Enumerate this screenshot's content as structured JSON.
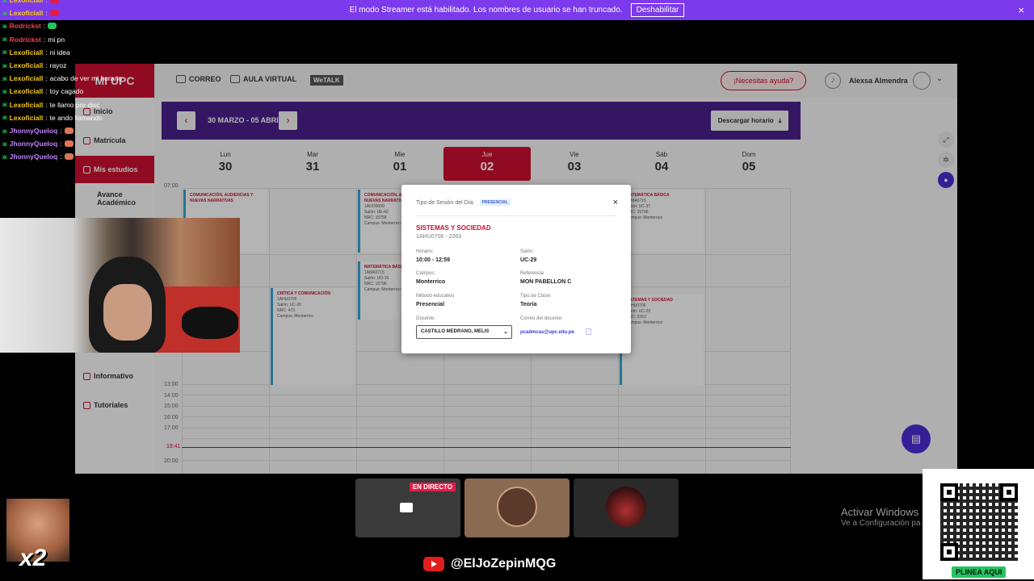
{
  "banner": {
    "message": "El modo Streamer está habilitado. Los nombres de usuario se han truncado.",
    "button": "Deshabilitar",
    "close": "×"
  },
  "portal": {
    "logo": "MI UPC",
    "nav": {
      "correo": "CORREO",
      "aula": "AULA VIRTUAL",
      "wetalk": "WeTALK"
    },
    "help": "¡Necesitas ayuda?",
    "user": "Alexsa Almendra",
    "sidebar": [
      {
        "label": "Inicio"
      },
      {
        "label": "Matrícula"
      },
      {
        "label": "Mis estudios"
      },
      {
        "label": "Avance Académico"
      },
      {
        "label": "Informativo"
      },
      {
        "label": "Tutoriales"
      }
    ],
    "week": {
      "range": "30 MARZO - 05 ABRIL",
      "download": "Descargar horario",
      "prev": "‹",
      "next": "›"
    },
    "days": [
      {
        "name": "Lun",
        "num": "30"
      },
      {
        "name": "Mar",
        "num": "31"
      },
      {
        "name": "Mie",
        "num": "01"
      },
      {
        "name": "Jue",
        "num": "02"
      },
      {
        "name": "Vie",
        "num": "03"
      },
      {
        "name": "Sáb",
        "num": "04"
      },
      {
        "name": "Dom",
        "num": "05"
      }
    ],
    "times": [
      "07:00",
      "13:00",
      "14:00",
      "15:00",
      "16:00",
      "17:00",
      "18:41",
      "20:00"
    ],
    "events": [
      {
        "title": "COMUNICACIÓN, AUDIENCIAS Y NUEVAS NARRATIVAS",
        "lines": []
      },
      {
        "title": "COMUNICACIÓN, AUDIENCIAS Y NUEVAS NARRATIVAS",
        "lines": [
          "1ADO0099",
          "Salón: UE-42",
          "NRC: 15758",
          "Campus: Monterrico"
        ]
      },
      {
        "title": "MATEMÁTICA BÁSICA",
        "lines": [
          "1AMA0715",
          "Salón: UO-15",
          "NRC: 15796",
          "Campus: Monterrico"
        ]
      },
      {
        "title": "MATEMÁTICA BÁSICA",
        "lines": [
          "1AMA0715",
          "Salón: UC-37",
          "NRC: 15796",
          "Campus: Monterrico"
        ]
      },
      {
        "title": "CRÍTICA Y COMUNICACIÓN",
        "lines": [
          "1AHU0705",
          "Salón: UC-26",
          "NRC: 473",
          "Campus: Monterrico"
        ]
      },
      {
        "title": "SISTEMAS Y SOCIEDAD",
        "lines": [
          "1AHU0706",
          "Salón: UC-29",
          "NRC: 2263",
          "Campus: Monterrico"
        ]
      }
    ]
  },
  "modal": {
    "session_label": "Tipo de Sesión del Día:",
    "session_value": "PRESENCIAL",
    "close": "×",
    "title": "SISTEMAS Y SOCIEDAD",
    "code": "1AHU0706 - 2263",
    "horario_lbl": "Horario:",
    "horario": "10:00 - 12:59",
    "salon_lbl": "Salón:",
    "salon": "UC-29",
    "campus_lbl": "Campus:",
    "campus": "Monterrico",
    "ref_lbl": "Referencia",
    "ref": "MON PABELLON C",
    "metodo_lbl": "Método educativo",
    "metodo": "Presencial",
    "tipo_lbl": "Tipo de Clase:",
    "tipo": "Teoría",
    "docente_lbl": "Docente:",
    "docente": "CASTILLO MEDRANO, MELIS",
    "correo_lbl": "Correo del docente:",
    "correo": "pcadmcas@upc.edu.pe"
  },
  "chat": [
    {
      "nick": "Lexoficiall",
      "msg": "",
      "color": "#facc15",
      "emo": "#e11d48"
    },
    {
      "nick": "Lexoficiall",
      "msg": "",
      "color": "#facc15",
      "emo": "#e11d48"
    },
    {
      "nick": "Rodrickst",
      "msg": "",
      "color": "#ef4444",
      "emo": "#22c55e"
    },
    {
      "nick": "Rodrickst",
      "msg": "mi pn",
      "color": "#ef4444",
      "emo": ""
    },
    {
      "nick": "Lexoficiall",
      "msg": "ni idea",
      "color": "#facc15",
      "emo": ""
    },
    {
      "nick": "Lexoficiall",
      "msg": "rayoz",
      "color": "#facc15",
      "emo": ""
    },
    {
      "nick": "Lexoficiall",
      "msg": "acabo de ver mi horario",
      "color": "#facc15",
      "emo": ""
    },
    {
      "nick": "Lexoficiall",
      "msg": "toy cagado",
      "color": "#facc15",
      "emo": ""
    },
    {
      "nick": "Lexoficiall",
      "msg": "te llamo por disc",
      "color": "#facc15",
      "emo": ""
    },
    {
      "nick": "Lexoficiall",
      "msg": "te ando llamando",
      "color": "#facc15",
      "emo": ""
    },
    {
      "nick": "JhonnyQueloq",
      "msg": "",
      "color": "#c084fc",
      "emo": "#d97757"
    },
    {
      "nick": "JhonnyQueloq",
      "msg": "",
      "color": "#c084fc",
      "emo": "#d97757"
    },
    {
      "nick": "JhonnyQueloq",
      "msg": "",
      "color": "#c084fc",
      "emo": "#d97757"
    }
  ],
  "stream": {
    "live": "EN DIRECTO",
    "handle": "@ElJoZepinMQG",
    "activate1": "Activar Windows",
    "activate2": "Ve a Configuración pa",
    "x2": "x2",
    "qr_button": "PLINEA AQUI"
  }
}
